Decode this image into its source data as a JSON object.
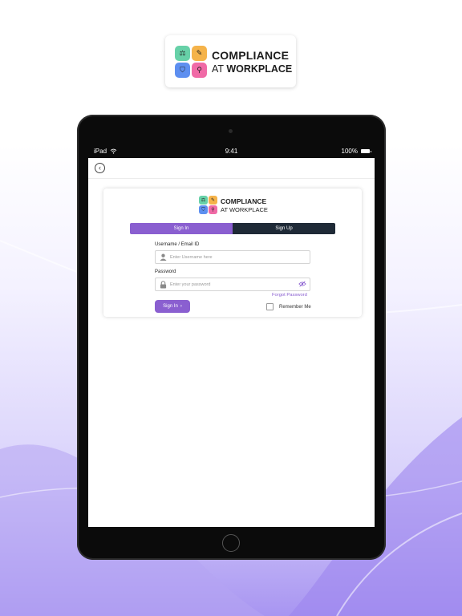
{
  "brand": {
    "line1": "COMPLIANCE",
    "line2_prefix": "AT",
    "line2_bold": "WORKPLACE",
    "colors": [
      "#67d1a8",
      "#f5b34a",
      "#5d8ff0",
      "#f06aa6"
    ],
    "icons": [
      "gavel-icon",
      "document-icon",
      "shield-icon",
      "magnifier-icon"
    ]
  },
  "status_bar": {
    "device": "iPad",
    "time": "9:41",
    "battery": "100%"
  },
  "card_brand": {
    "line1": "COMPLIANCE",
    "line2": "AT WORKPLACE"
  },
  "tabs": {
    "sign_in": "Sign In",
    "sign_up": "Sign Up"
  },
  "form": {
    "username_label": "Username / Email ID",
    "username_placeholder": "Enter Username here",
    "password_label": "Password",
    "password_placeholder": "Enter your password",
    "forgot_password": "Forgot Password",
    "signin_button": "Sign In",
    "remember_me": "Remember Me"
  },
  "theme": {
    "accent": "#8a5fd0",
    "dark_tab": "#1f2a37"
  }
}
